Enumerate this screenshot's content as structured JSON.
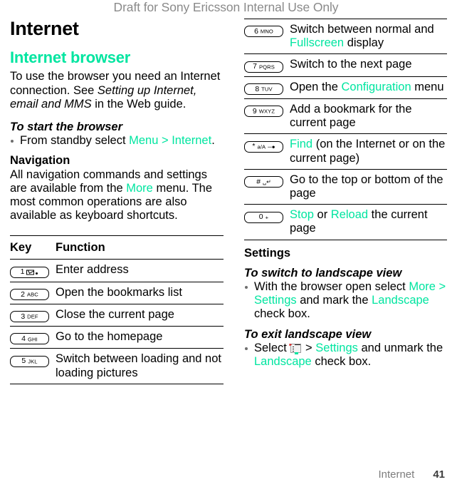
{
  "document": {
    "draft_notice": "Draft for Sony Ericsson Internal Use Only",
    "footer_section": "Internet",
    "footer_page": "41",
    "accent_color": "#00e5a0",
    "draft_color": "#8a8a8a"
  },
  "left": {
    "page_title": "Internet",
    "section_title": "Internet browser",
    "intro": {
      "part1": "To use the browser you need an Internet connection. See ",
      "italic": "Setting up Internet, email and MMS",
      "part2": " in the Web guide."
    },
    "start_browser": {
      "heading": "To start the browser",
      "bullet": {
        "part1": "From standby select ",
        "link": "Menu > Internet",
        "part2": "."
      }
    },
    "navigation": {
      "heading": "Navigation",
      "part1": "All navigation commands and settings are available from the ",
      "link": "More",
      "part2": " menu. The most common operations are also available as keyboard shortcuts."
    },
    "table": {
      "header_key": "Key",
      "header_function": "Function",
      "rows": [
        {
          "key": {
            "num": "1",
            "letters": "",
            "glyph": "voicemail-envelope"
          },
          "function_parts": [
            {
              "text": "Enter address",
              "style": "plain"
            }
          ]
        },
        {
          "key": {
            "num": "2",
            "letters": "ABC",
            "glyph": ""
          },
          "function_parts": [
            {
              "text": "Open the bookmarks list",
              "style": "plain"
            }
          ]
        },
        {
          "key": {
            "num": "3",
            "letters": "DEF",
            "glyph": ""
          },
          "function_parts": [
            {
              "text": "Close the current page",
              "style": "plain"
            }
          ]
        },
        {
          "key": {
            "num": "4",
            "letters": "GHI",
            "glyph": ""
          },
          "function_parts": [
            {
              "text": "Go to the homepage",
              "style": "plain"
            }
          ]
        },
        {
          "key": {
            "num": "5",
            "letters": "JKL",
            "glyph": ""
          },
          "function_parts": [
            {
              "text": "Switch between loading and not loading pictures",
              "style": "plain"
            }
          ]
        }
      ]
    }
  },
  "right": {
    "table": {
      "rows": [
        {
          "key": {
            "num": "6",
            "letters": "MNO",
            "glyph": ""
          },
          "function_parts": [
            {
              "text": "Switch between normal and ",
              "style": "plain"
            },
            {
              "text": "Fullscreen",
              "style": "link"
            },
            {
              "text": " display",
              "style": "plain"
            }
          ]
        },
        {
          "key": {
            "num": "7",
            "letters": "PQRS",
            "glyph": ""
          },
          "function_parts": [
            {
              "text": "Switch to the next page",
              "style": "plain"
            }
          ]
        },
        {
          "key": {
            "num": "8",
            "letters": "TUV",
            "glyph": ""
          },
          "function_parts": [
            {
              "text": "Open the ",
              "style": "plain"
            },
            {
              "text": "Configuration",
              "style": "link"
            },
            {
              "text": " menu",
              "style": "plain"
            }
          ]
        },
        {
          "key": {
            "num": "9",
            "letters": "WXYZ",
            "glyph": ""
          },
          "function_parts": [
            {
              "text": "Add a bookmark for the current page",
              "style": "plain"
            }
          ]
        },
        {
          "key": {
            "num": "*",
            "letters": "a/A",
            "glyph": "lock-key"
          },
          "function_parts": [
            {
              "text": "Find",
              "style": "link"
            },
            {
              "text": " (on the Internet or on the current page)",
              "style": "plain"
            }
          ]
        },
        {
          "key": {
            "num": "#",
            "letters": "",
            "glyph": "space-shift"
          },
          "function_parts": [
            {
              "text": "Go to the top or bottom of the page",
              "style": "plain"
            }
          ]
        },
        {
          "key": {
            "num": "0",
            "letters": "+",
            "glyph": ""
          },
          "function_parts": [
            {
              "text": "Stop",
              "style": "link"
            },
            {
              "text": " or ",
              "style": "plain"
            },
            {
              "text": "Reload",
              "style": "link"
            },
            {
              "text": " the current page",
              "style": "plain"
            }
          ]
        }
      ]
    },
    "settings": {
      "heading": "Settings",
      "switch_landscape": {
        "heading": "To switch to landscape view",
        "bullet_parts": [
          {
            "text": "With the browser open select ",
            "style": "plain"
          },
          {
            "text": "More > Settings",
            "style": "link"
          },
          {
            "text": " and mark the ",
            "style": "plain"
          },
          {
            "text": "Landscape",
            "style": "link"
          },
          {
            "text": " check box.",
            "style": "plain"
          }
        ]
      },
      "exit_landscape": {
        "heading": "To exit landscape view",
        "bullet_parts_pre": [
          {
            "text": "Select ",
            "style": "plain"
          }
        ],
        "icon": "menu-list-icon",
        "bullet_parts_post": [
          {
            "text": " > ",
            "style": "plain"
          },
          {
            "text": "Settings",
            "style": "link"
          },
          {
            "text": " and unmark the ",
            "style": "plain"
          },
          {
            "text": "Landscape",
            "style": "link"
          },
          {
            "text": " check box.",
            "style": "plain"
          }
        ]
      }
    }
  }
}
